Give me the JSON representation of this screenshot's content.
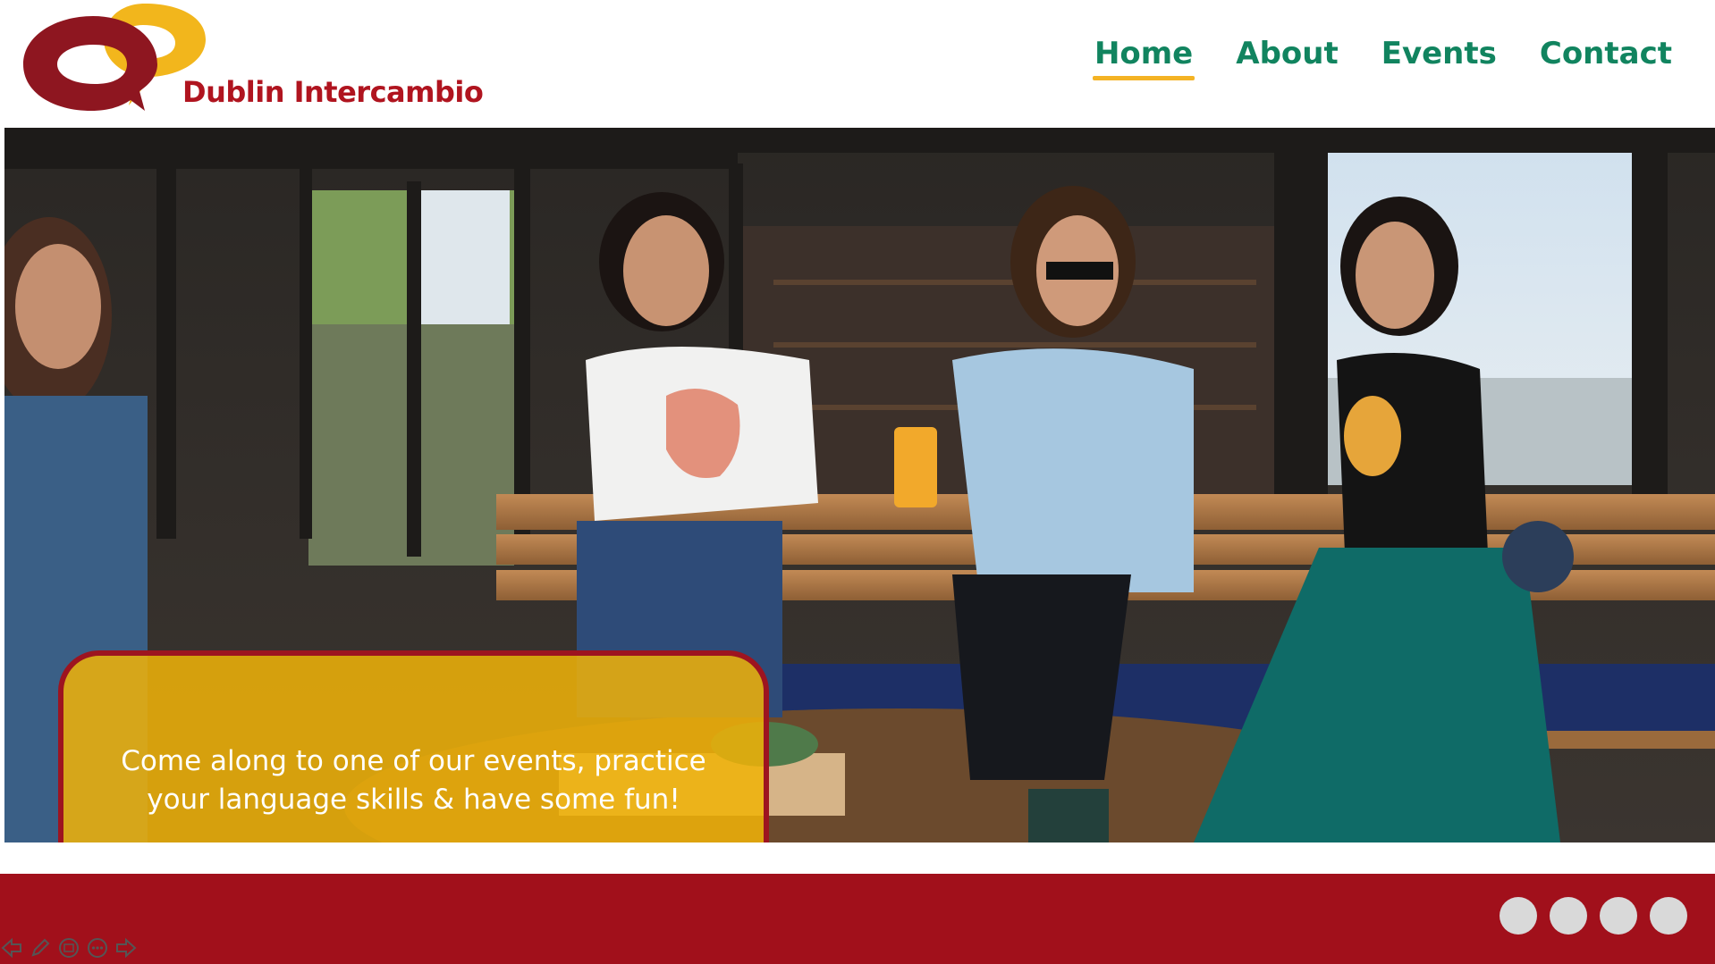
{
  "brand": {
    "name": "Dublin Intercambio",
    "logo_icon": "speech-bubbles-logo"
  },
  "nav": {
    "items": [
      {
        "label": "Home",
        "active": true
      },
      {
        "label": "About",
        "active": false
      },
      {
        "label": "Events",
        "active": false
      },
      {
        "label": "Contact",
        "active": false
      }
    ]
  },
  "hero": {
    "image": "photo of friends laughing at an outdoor bar",
    "callout": "Come along to one of our events, practice your language skills & have some fun!"
  },
  "carousel": {
    "dot_count": 4
  },
  "slideshow_controls": {
    "icons": [
      "prev-arrow-icon",
      "pen-icon",
      "slides-icon",
      "more-icon",
      "next-arrow-icon"
    ]
  },
  "colors": {
    "brand_red": "#a1101b",
    "nav_green": "#11845f",
    "accent_yellow": "#f4b324"
  }
}
